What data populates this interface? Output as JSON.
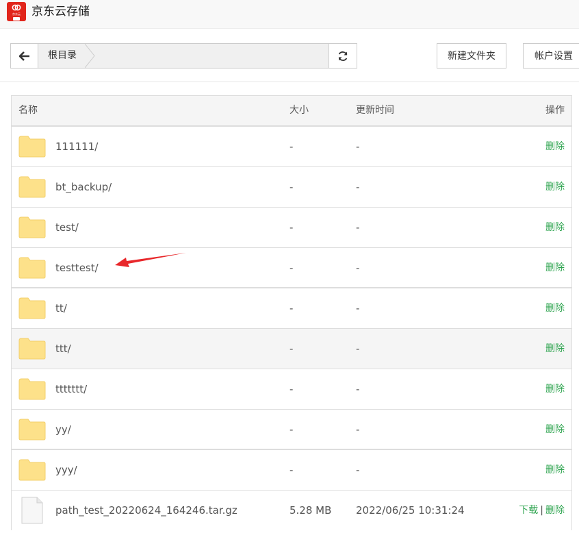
{
  "header": {
    "title": "京东云存储",
    "logo_sub": "京东云"
  },
  "toolbar": {
    "breadcrumb": [
      "根目录"
    ],
    "new_folder_label": "新建文件夹",
    "account_label": "帐户设置"
  },
  "table": {
    "columns": [
      "名称",
      "大小",
      "更新时间",
      "操作"
    ],
    "rows": [
      {
        "name": "111111/",
        "size": "-",
        "time": "-",
        "type": "folder"
      },
      {
        "name": "bt_backup/",
        "size": "-",
        "time": "-",
        "type": "folder"
      },
      {
        "name": "test/",
        "size": "-",
        "time": "-",
        "type": "folder"
      },
      {
        "name": "testtest/",
        "size": "-",
        "time": "-",
        "type": "folder"
      },
      {
        "name": "tt/",
        "size": "-",
        "time": "-",
        "type": "folder"
      },
      {
        "name": "ttt/",
        "size": "-",
        "time": "-",
        "type": "folder"
      },
      {
        "name": "ttttttt/",
        "size": "-",
        "time": "-",
        "type": "folder"
      },
      {
        "name": "yy/",
        "size": "-",
        "time": "-",
        "type": "folder"
      },
      {
        "name": "yyy/",
        "size": "-",
        "time": "-",
        "type": "folder"
      },
      {
        "name": "path_test_20220624_164246.tar.gz",
        "size": "5.28 MB",
        "time": "2022/06/25 10:31:24",
        "type": "file"
      }
    ],
    "delete_label": "删除",
    "download_label": "下载",
    "op_separator": "|"
  },
  "colors": {
    "link": "#2ea44f",
    "folder": "#fde18a",
    "annotation": "#e8282b",
    "brand": "#e1251b"
  }
}
